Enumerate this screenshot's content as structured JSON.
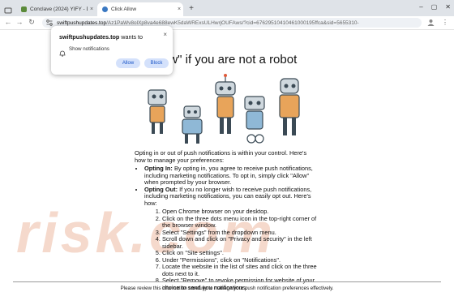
{
  "browser": {
    "tabs": [
      {
        "title": "Conclave (2024) YIFY - Downlo",
        "favicon_color": "#5b8a3a",
        "active": false
      },
      {
        "title": "Click Allow",
        "favicon_color": "#3a78c2",
        "active": true
      }
    ],
    "new_tab_symbol": "+",
    "url_domain": "swiftpushupdates.top",
    "url_rest": "/Az1PaWv8olXp8va4e688ewK5daWRExsULHwrjOUFAws/?cid=67629510410461000195ffca&sid=5655310-",
    "window_controls": [
      "–",
      "▢",
      "✕"
    ]
  },
  "popup": {
    "domain": "swiftpushupdates.top",
    "wants_to": " wants to",
    "close": "×",
    "permission": "Show notifications",
    "allow_label": "Allow",
    "block_label": "Block"
  },
  "page": {
    "heading": "ow\" if you are not a robot",
    "watermark": "risk.com",
    "intro": "Opting in or out of push notifications is within your control. Here's how to manage your preferences:",
    "bullets": [
      {
        "bold": "Opting In:",
        "text": " By opting in, you agree to receive push notifications, including marketing notifications. To opt in, simply click \"Allow\" when prompted by your browser."
      },
      {
        "bold": "Opting Out:",
        "text": " If you no longer wish to receive push notifications, including marketing notifications, you can easily opt out. Here's how:"
      }
    ],
    "steps": [
      "Open Chrome browser on your desktop.",
      "Click on the three dots menu icon in the top-right corner of the browser window.",
      "Select \"Settings\" from the dropdown menu.",
      "Scroll down and click on \"Privacy and security\" in the left sidebar.",
      "Click on \"Site settings\".",
      "Under \"Permissions\", click on \"Notifications\".",
      "Locate the website in the list of sites and click on the three dots next to it.",
      "Select \"Remove\" to revoke permission for website of your choice to send you notifications."
    ],
    "footer": "Please review this information carefully to manage your push notification preferences effectively."
  }
}
